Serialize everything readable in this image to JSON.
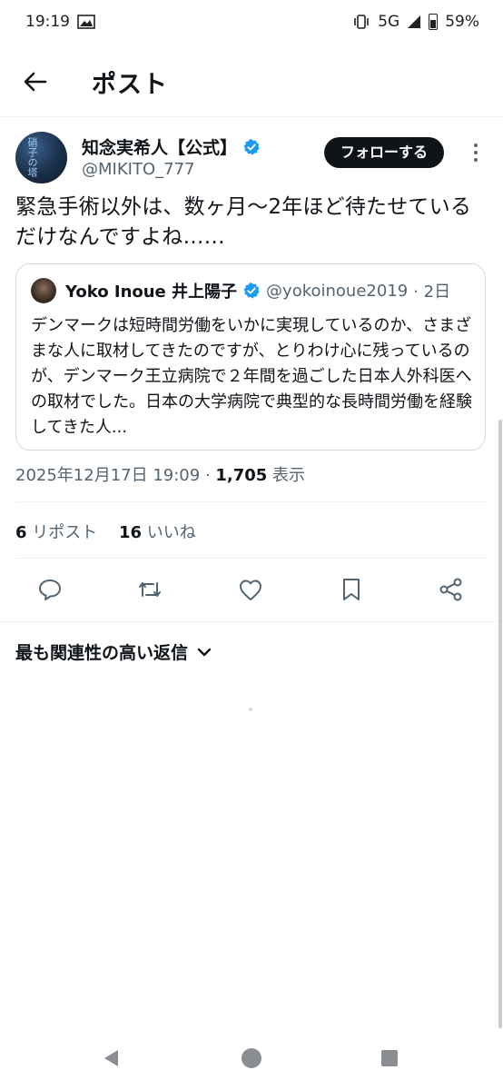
{
  "status_bar": {
    "time": "19:19",
    "network": "5G",
    "battery": "59%"
  },
  "header": {
    "title": "ポスト"
  },
  "post": {
    "author_name": "知念実希人【公式】",
    "author_handle": "@MIKITO_777",
    "avatar_text": "硝子の塔",
    "follow_label": "フォローする",
    "text": "緊急手術以外は、数ヶ月〜2年ほど待たせているだけなんですよね……",
    "timestamp": "2025年12月17日 19:09",
    "separator": " · ",
    "views_count": "1,705",
    "views_label": " 表示"
  },
  "quote": {
    "author_name": "Yoko Inoue 井上陽子",
    "author_handle": "@yokoinoue2019",
    "time_ago": "· 2日",
    "text": "デンマークは短時間労働をいかに実現しているのか、さまざまな人に取材してきたのですが、とりわけ心に残っているのが、デンマーク王立病院で２年間を過ごした日本人外科医への取材でした。日本の大学病院で典型的な長時間労働を経験してきた人..."
  },
  "stats": {
    "reposts_count": "6",
    "reposts_label": " リポスト",
    "likes_count": "16",
    "likes_label": " いいね"
  },
  "replies": {
    "sort_label": "最も関連性の高い返信"
  },
  "colors": {
    "text_primary": "#0f1419",
    "text_secondary": "#536471",
    "verified_blue": "#1d9bf0",
    "border": "#cfd9de"
  }
}
